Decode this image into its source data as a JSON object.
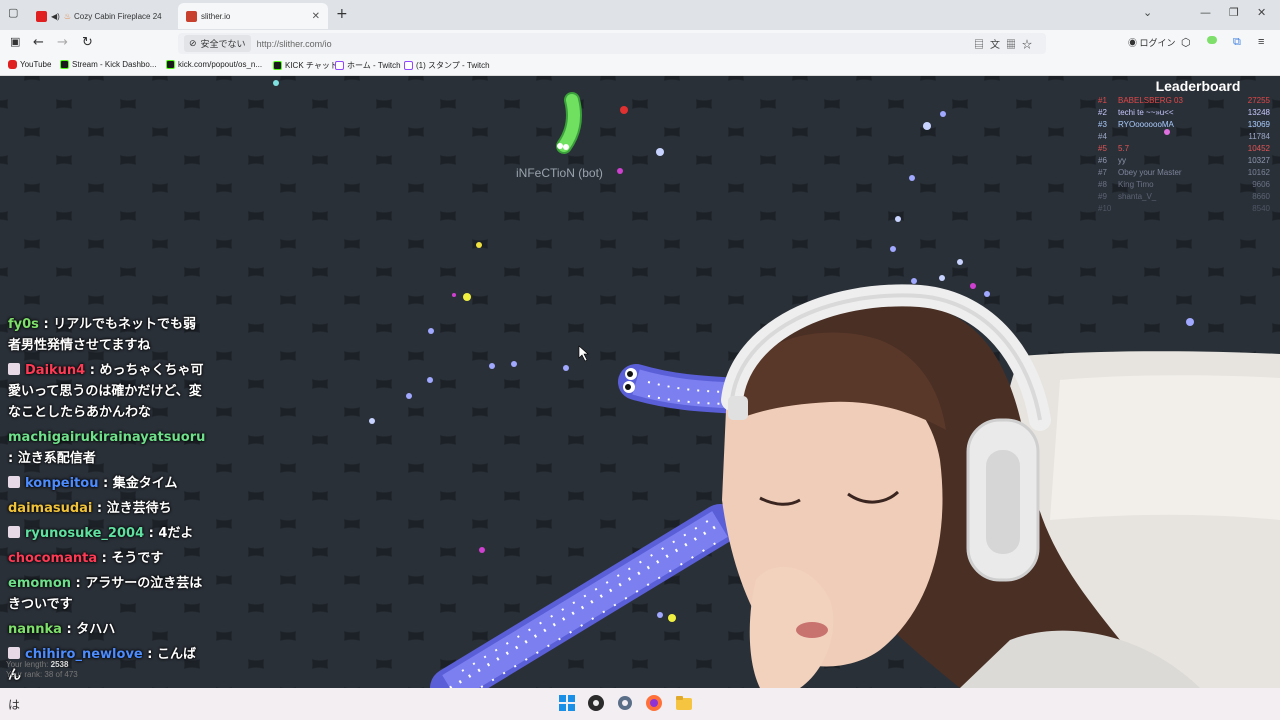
{
  "browser": {
    "tabs": [
      {
        "label": "Cozy Cabin Fireplace 24",
        "active": false
      },
      {
        "label": "slither.io",
        "active": true
      }
    ],
    "insecure_label": "安全でない",
    "url": "http://slither.com/io",
    "login_label": "ログイン"
  },
  "bookmarks": [
    {
      "label": "YouTube",
      "icon": "youtube-icon"
    },
    {
      "label": "Stream - Kick Dashbo...",
      "icon": "kick-icon"
    },
    {
      "label": "kick.com/popout/os_n...",
      "icon": "kick-icon"
    },
    {
      "label": "KICK チャット",
      "icon": "kick-icon"
    },
    {
      "label": "ホーム - Twitch",
      "icon": "twitch-icon"
    },
    {
      "label": "(1) スタンプ - Twitch",
      "icon": "twitch-icon"
    }
  ],
  "game": {
    "bot_name": "iNFeCTioN (bot)",
    "leaderboard_title": "Leaderboard",
    "leaderboard": [
      {
        "rank": "#1",
        "name": "BABELSBERG 03",
        "score": "27255",
        "color": "#e04848"
      },
      {
        "rank": "#2",
        "name": "techi te ~~»u<<",
        "score": "13248",
        "color": "#c9c9ff"
      },
      {
        "rank": "#3",
        "name": "RYOooooooMA",
        "score": "13069",
        "color": "#aaccff"
      },
      {
        "rank": "#4",
        "name": "",
        "score": "11784",
        "color": "#9aa7c7"
      },
      {
        "rank": "#5",
        "name": "5.7",
        "score": "10452",
        "color": "#e05555"
      },
      {
        "rank": "#6",
        "name": "yy",
        "score": "10327",
        "color": "#8f97b0"
      },
      {
        "rank": "#7",
        "name": "Obey your Master",
        "score": "10162",
        "color": "#7c849a"
      },
      {
        "rank": "#8",
        "name": "King Timo",
        "score": "9606",
        "color": "#6a7184"
      },
      {
        "rank": "#9",
        "name": "shanta_V_",
        "score": "8660",
        "color": "#5d6475"
      },
      {
        "rank": "#10",
        "name": "",
        "score": "8540",
        "color": "#4f5564"
      }
    ],
    "your_length_label": "Your length:",
    "your_length": "2538",
    "your_rank_label": "Your rank: 38 of 473"
  },
  "chat": [
    {
      "user": "fy0s",
      "color": "#7ee06a",
      "badge": false,
      "text": "リアルでもネットでも弱者男性発情させてますね"
    },
    {
      "user": "Daikun4",
      "color": "#ff3a55",
      "badge": true,
      "text": "めっちゃくちゃ可愛いって思うのは確かだけど、変なことしたらあかんわな"
    },
    {
      "user": "machigairukirainayatsuoru",
      "color": "#6ee08a",
      "badge": false,
      "text": "泣き系配信者"
    },
    {
      "user": "konpeitou",
      "color": "#4d8cff",
      "badge": true,
      "text": "集金タイム"
    },
    {
      "user": "daimasudai",
      "color": "#f0c23a",
      "badge": false,
      "text": "泣き芸待ち"
    },
    {
      "user": "ryunosuke_2004",
      "color": "#5fe0a0",
      "badge": true,
      "text": "4だよ"
    },
    {
      "user": "chocomanta",
      "color": "#ff3a55",
      "badge": false,
      "text": "そうです"
    },
    {
      "user": "emomon",
      "color": "#6ee08a",
      "badge": false,
      "text": "アラサーの泣き芸はきついです"
    },
    {
      "user": "nannka",
      "color": "#7ee06a",
      "badge": false,
      "text": "タハハ"
    },
    {
      "user": "chihiro_newlove",
      "color": "#4d8cff",
      "badge": true,
      "text": "こんばん"
    }
  ],
  "taskbar": {
    "input_char": "は"
  }
}
